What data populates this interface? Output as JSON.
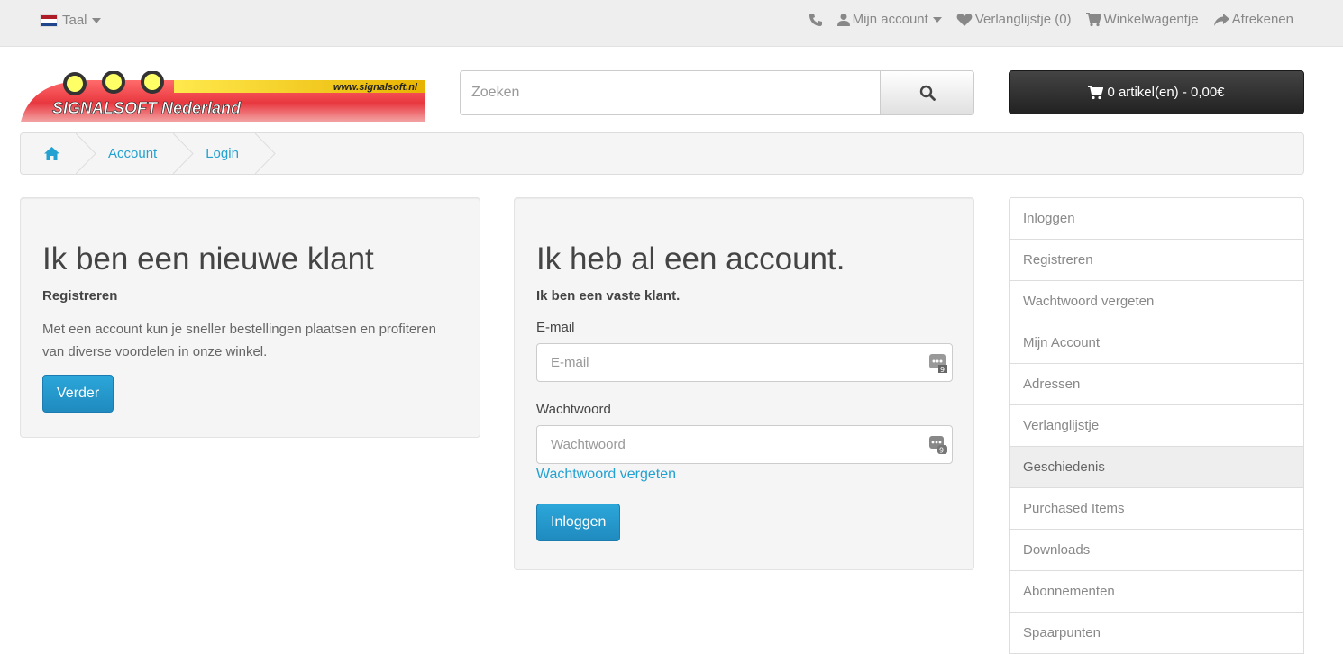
{
  "topbar": {
    "language_label": "Taal",
    "my_account": "Mijn account",
    "wishlist": "Verlanglijstje (0)",
    "cart": "Winkelwagentje",
    "checkout": "Afrekenen"
  },
  "header": {
    "logo_text": "SIGNALSOFT Nederland",
    "logo_url_text": "www.signalsoft.nl",
    "search_placeholder": "Zoeken",
    "cart_label": "0 artikel(en) - 0,00€"
  },
  "breadcrumb": [
    "Account",
    "Login"
  ],
  "new_customer": {
    "title": "Ik ben een nieuwe klant",
    "subtitle": "Registreren",
    "text": "Met een account kun je sneller bestellingen plaatsen en profiteren van diverse voordelen in onze winkel.",
    "button": "Verder"
  },
  "returning_customer": {
    "title": "Ik heb al een account.",
    "subtitle": "Ik ben een vaste klant.",
    "email_label": "E-mail",
    "email_placeholder": "E-mail",
    "password_label": "Wachtwoord",
    "password_placeholder": "Wachtwoord",
    "forgot_link": "Wachtwoord vergeten",
    "login_button": "Inloggen"
  },
  "sidebar": {
    "items": [
      {
        "label": "Inloggen"
      },
      {
        "label": "Registreren"
      },
      {
        "label": "Wachtwoord vergeten"
      },
      {
        "label": "Mijn Account"
      },
      {
        "label": "Adressen"
      },
      {
        "label": "Verlanglijstje"
      },
      {
        "label": "Geschiedenis"
      },
      {
        "label": "Purchased Items"
      },
      {
        "label": "Downloads"
      },
      {
        "label": "Abonnementen"
      },
      {
        "label": "Spaarpunten"
      }
    ],
    "active_index": 6
  },
  "colors": {
    "link": "#23a1d1",
    "primary_button": "#1f8bbf",
    "cart_bg": "#222222"
  }
}
